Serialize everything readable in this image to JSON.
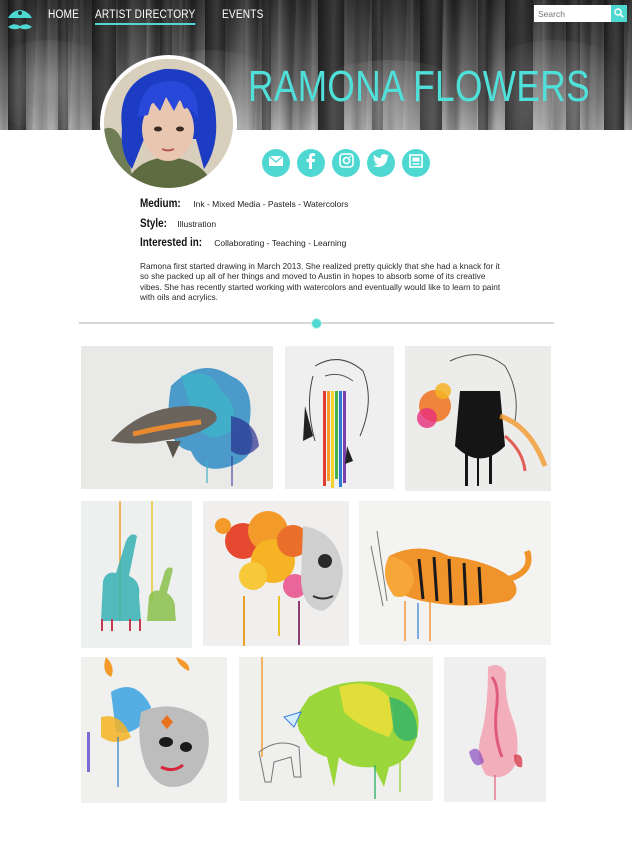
{
  "nav": {
    "items": [
      {
        "label": "HOME",
        "active": false
      },
      {
        "label": "ARTIST DIRECTORY",
        "active": true
      },
      {
        "label": "EVENTS",
        "active": false
      }
    ]
  },
  "search": {
    "placeholder": "Search",
    "value": ""
  },
  "artist": {
    "name": "RAMONA FLOWERS",
    "medium_label": "Medium:",
    "medium_value": "Ink - Mixed Media - Pastels - Watercolors",
    "style_label": "Style:",
    "style_value": "Illustration",
    "interested_label": "Interested in:",
    "interested_value": "Collaborating - Teaching - Learning",
    "bio": "Ramona first started drawing in March 2013. She realized pretty quickly that she had a knack for it so she packed up all of her things and moved to Austin in hopes to absorb some of its creative vibes. She has recently started working with watercolors and eventually would like to learn to paint with oils and acrylics."
  },
  "social": [
    {
      "icon": "email-icon"
    },
    {
      "icon": "facebook-icon"
    },
    {
      "icon": "instagram-icon"
    },
    {
      "icon": "twitter-icon"
    },
    {
      "icon": "website-icon"
    }
  ],
  "gallery": [
    {
      "subject": "dolphin"
    },
    {
      "subject": "woman-rainbow-drips"
    },
    {
      "subject": "masked-woman"
    },
    {
      "subject": "giraffes"
    },
    {
      "subject": "flowers-skull-woman"
    },
    {
      "subject": "tiger"
    },
    {
      "subject": "butterfly-woman"
    },
    {
      "subject": "rhinoceros"
    },
    {
      "subject": "pink-figure"
    }
  ],
  "colors": {
    "accent": "#4fd8d2",
    "name": "#4fe0da"
  }
}
